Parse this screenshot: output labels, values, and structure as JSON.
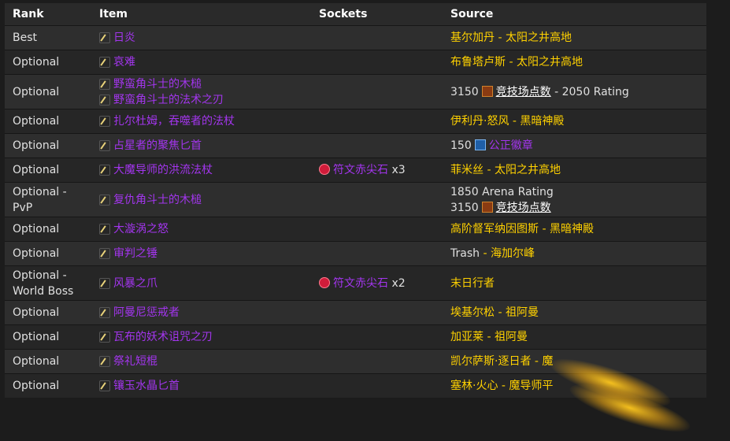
{
  "headers": {
    "rank": "Rank",
    "item": "Item",
    "sockets": "Sockets",
    "source": "Source"
  },
  "rows": [
    {
      "rank": "Best",
      "items": [
        "日炎"
      ],
      "socket_label": "",
      "socket_count": "",
      "source": "基尔加丹 - 太阳之井高地"
    },
    {
      "rank": "Optional",
      "items": [
        "哀难"
      ],
      "socket_label": "",
      "socket_count": "",
      "source": "布鲁塔卢斯 - 太阳之井高地"
    },
    {
      "rank": "Optional",
      "items": [
        "野蛮角斗士的木槌",
        "野蛮角斗士的法术之刃"
      ],
      "socket_label": "",
      "socket_count": "",
      "source_pre": "3150",
      "source_link": "竞技场点数",
      "source_post": "- 2050 Rating"
    },
    {
      "rank": "Optional",
      "items": [
        "扎尔杜姆，吞噬者的法杖"
      ],
      "socket_label": "",
      "socket_count": "",
      "source": "伊利丹·怒风 - 黑暗神殿"
    },
    {
      "rank": "Optional",
      "items": [
        "占星者的聚焦匕首"
      ],
      "socket_label": "",
      "socket_count": "",
      "source_pre": "150",
      "source_link": "公正徽章"
    },
    {
      "rank": "Optional",
      "items": [
        "大魔导师的洪流法杖"
      ],
      "socket_label": "符文赤尖石",
      "socket_count": "x3",
      "source": "菲米丝 - 太阳之井高地"
    },
    {
      "rank": "Optional - PvP",
      "items": [
        "复仇角斗士的木槌"
      ],
      "socket_label": "",
      "socket_count": "",
      "source_line1": "1850 Arena Rating",
      "source_pre": "3150",
      "source_link": "竞技场点数"
    },
    {
      "rank": "Optional",
      "items": [
        "大漩涡之怒"
      ],
      "socket_label": "",
      "socket_count": "",
      "source": "高阶督军纳因图斯 - 黑暗神殿"
    },
    {
      "rank": "Optional",
      "items": [
        "审判之锤"
      ],
      "socket_label": "",
      "socket_count": "",
      "source_pre_plain": "Trash",
      "source": " - 海加尔峰"
    },
    {
      "rank": "Optional - World Boss",
      "items": [
        "风暴之爪"
      ],
      "socket_label": "符文赤尖石",
      "socket_count": "x2",
      "source": "末日行者"
    },
    {
      "rank": "Optional",
      "items": [
        "阿曼尼惩戒者"
      ],
      "socket_label": "",
      "socket_count": "",
      "source": "埃基尔松 - 祖阿曼"
    },
    {
      "rank": "Optional",
      "items": [
        "瓦布的妖术诅咒之刃"
      ],
      "socket_label": "",
      "socket_count": "",
      "source": "加亚莱 - 祖阿曼"
    },
    {
      "rank": "Optional",
      "items": [
        "祭礼短棍"
      ],
      "socket_label": "",
      "socket_count": "",
      "source": "凯尔萨斯·逐日者 - 魔"
    },
    {
      "rank": "Optional",
      "items": [
        "镶玉水晶匕首"
      ],
      "socket_label": "",
      "socket_count": "",
      "source": "塞林·火心 - 魔导师平"
    }
  ],
  "colors": {
    "epic": "#a335ee",
    "source": "#ffd100",
    "text": "#e0e0e0"
  }
}
